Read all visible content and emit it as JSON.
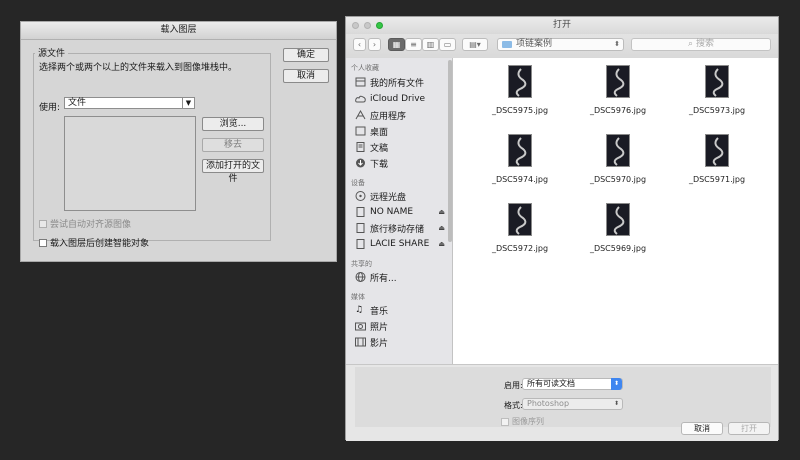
{
  "ps_dialog": {
    "title": "载入图层",
    "group_label": "源文件",
    "instruction": "选择两个或两个以上的文件来载入到图像堆栈中。",
    "use_label": "使用:",
    "use_value": "文件",
    "ok_label": "确定",
    "cancel_label": "取消",
    "browse_label": "浏览...",
    "remove_label": "移去",
    "add_open_label": "添加打开的文件",
    "auto_align_label": "尝试自动对齐源图像",
    "smart_object_label": "载入图层后创建智能对象"
  },
  "open_panel": {
    "title": "打开",
    "path_folder": "项链案例",
    "search_placeholder": "搜索",
    "sidebar": {
      "favorites_header": "个人收藏",
      "favorites": [
        "我的所有文件",
        "iCloud Drive",
        "应用程序",
        "桌面",
        "文稿",
        "下载"
      ],
      "devices_header": "设备",
      "devices": [
        "远程光盘",
        "NO NAME",
        "旅行移动存储",
        "LACIE SHARE"
      ],
      "shared_header": "共享的",
      "shared": [
        "所有..."
      ],
      "media_header": "媒体",
      "media": [
        "音乐",
        "照片",
        "影片"
      ]
    },
    "files": [
      "_DSC5975.jpg",
      "_DSC5976.jpg",
      "_DSC5973.jpg",
      "_DSC5974.jpg",
      "_DSC5970.jpg",
      "_DSC5971.jpg",
      "_DSC5972.jpg",
      "_DSC5969.jpg"
    ],
    "enable_label": "启用:",
    "enable_value": "所有可读文档",
    "format_label": "格式:",
    "format_value": "Photoshop",
    "sequence_label": "图像序列",
    "cancel_label": "取消",
    "open_label": "打开"
  },
  "colors": {
    "accent_blue": "#3f86f0",
    "traffic_green": "#35c646",
    "desktop": "#262626"
  }
}
